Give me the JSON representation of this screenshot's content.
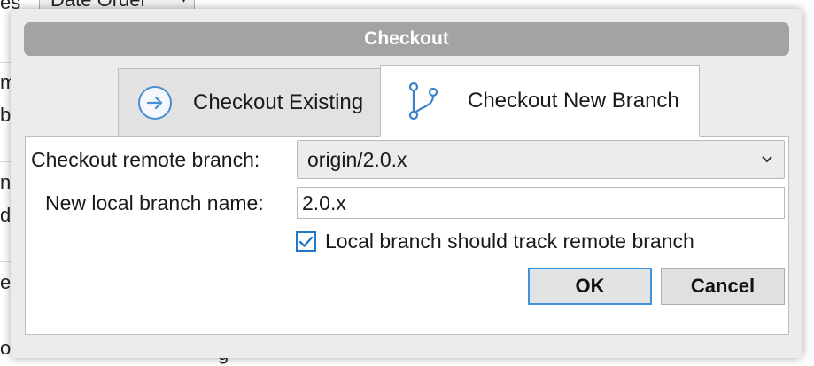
{
  "background": {
    "dropdown_label": "Date Order",
    "fragments": [
      "es",
      "m",
      "b",
      "n",
      "d",
      "er",
      "o"
    ],
    "bottom_fragment": "g"
  },
  "dialog": {
    "title": "Checkout",
    "tabs": [
      {
        "label": "Checkout Existing",
        "icon": "arrow-circle-icon",
        "active": false
      },
      {
        "label": "Checkout New Branch",
        "icon": "branch-icon",
        "active": true
      }
    ],
    "remote_branch_label": "Checkout remote branch:",
    "remote_branch_value": "origin/2.0.x",
    "local_name_label": "New local branch name:",
    "local_name_value": "2.0.x",
    "track_label": "Local branch should track remote branch",
    "track_checked": true,
    "ok_label": "OK",
    "cancel_label": "Cancel",
    "accent_color": "#1f78c9",
    "title_bar_color": "#a3a3a3"
  }
}
